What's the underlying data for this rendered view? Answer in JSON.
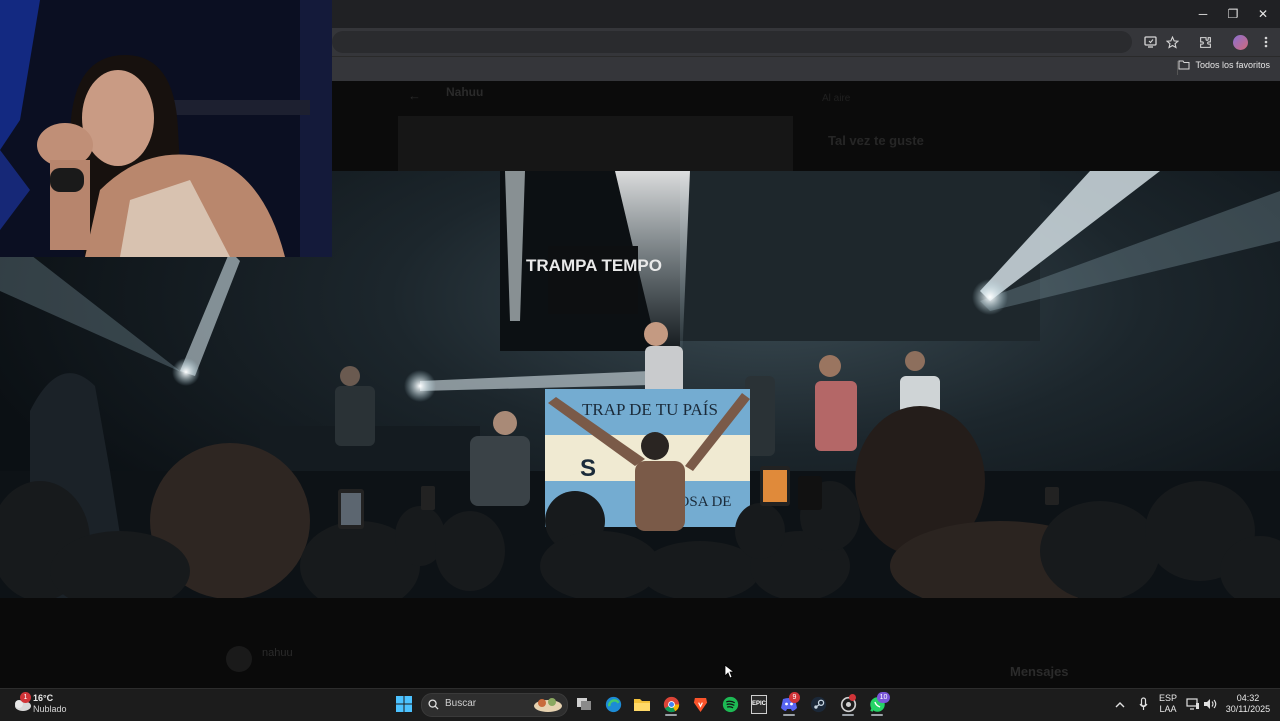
{
  "browser": {
    "window_controls": {
      "minimize": "─",
      "maximize": "❐",
      "close": "✕"
    },
    "toolbar_icons": [
      "cast-icon",
      "star-icon",
      "extensions-icon",
      "profile-icon",
      "menu-icon"
    ],
    "bookmarks_bar": {
      "all_bookmarks_label": "Todos los favoritos"
    },
    "page_behind": {
      "channel_title": "Nahuu",
      "side_label": "Al aire",
      "suggest_heading": "Tal vez te guste",
      "bottom_user": "nahuu",
      "chat_heading": "Mensajes"
    }
  },
  "video": {
    "stage_sign": "TRAMPA TEMPO",
    "flag_text_top": "TRAP DE TU PAÍS",
    "flag_text_bottom": "COSA DE",
    "flag_emblem": "S"
  },
  "taskbar": {
    "weather": {
      "temp": "16°C",
      "desc": "Nublado",
      "badge": "1"
    },
    "search_placeholder": "Buscar",
    "apps": [
      "windows-start-icon",
      "search-icon",
      "task-view-icon",
      "edge-icon",
      "file-explorer-icon",
      "chrome-icon",
      "brave-icon",
      "spotify-icon",
      "epic-games-icon",
      "discord-icon",
      "steam-icon",
      "app-icon",
      "whatsapp-icon"
    ],
    "epic_label": "EPIC",
    "discord_badge": "9",
    "whatsapp_badge": "10",
    "language": {
      "lang": "ESP",
      "layout": "LAA"
    },
    "clock": {
      "time": "04:32",
      "date": "30/11/2025"
    }
  },
  "colors": {
    "chrome_dark": "#202124",
    "chrome_toolbar": "#35363a",
    "taskbar": "#1c1c1c",
    "flag_blue": "#74acd1",
    "flag_white": "#f0ead2",
    "spotify_green": "#1db954",
    "whatsapp_green": "#25d366",
    "brave_orange": "#fb542b"
  }
}
